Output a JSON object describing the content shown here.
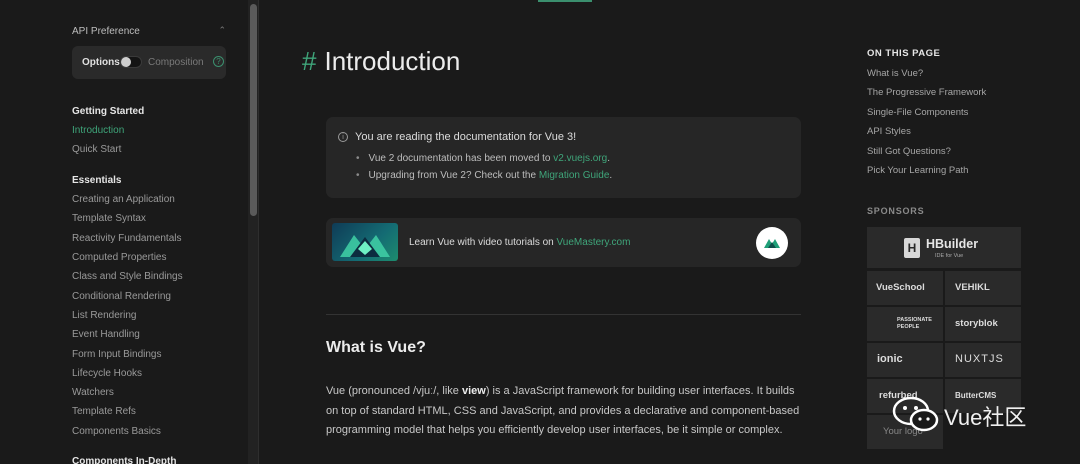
{
  "sidebar": {
    "api_preference": {
      "label": "API Preference",
      "options_label": "Options",
      "composition_label": "Composition"
    },
    "sections": [
      {
        "heading": "Getting Started",
        "items": [
          "Introduction",
          "Quick Start"
        ]
      },
      {
        "heading": "Essentials",
        "items": [
          "Creating an Application",
          "Template Syntax",
          "Reactivity Fundamentals",
          "Computed Properties",
          "Class and Style Bindings",
          "Conditional Rendering",
          "List Rendering",
          "Event Handling",
          "Form Input Bindings",
          "Lifecycle Hooks",
          "Watchers",
          "Template Refs",
          "Components Basics"
        ]
      },
      {
        "heading": "Components In-Depth",
        "items": []
      }
    ],
    "active_item": "Introduction"
  },
  "main": {
    "title_hash": "#",
    "title": "Introduction",
    "notice": {
      "title": "You are reading the documentation for Vue 3!",
      "item1_prefix": "Vue 2 documentation has been moved to ",
      "item1_link": "v2.vuejs.org",
      "item1_suffix": ".",
      "item2_prefix": "Upgrading from Vue 2? Check out the ",
      "item2_link": "Migration Guide",
      "item2_suffix": "."
    },
    "vuemastery": {
      "prefix": "Learn Vue with video tutorials on ",
      "link": "VueMastery.com"
    },
    "section_heading": "What is Vue?",
    "paragraph": {
      "p1": "Vue (pronounced /vjuː/, like ",
      "bold": "view",
      "p2": ") is a JavaScript framework for building user interfaces. It builds on top of standard HTML, CSS and JavaScript, and provides a declarative and component-based programming model that helps you efficiently develop user interfaces, be it simple or complex."
    }
  },
  "on_this_page": {
    "heading": "ON THIS PAGE",
    "items": [
      "What is Vue?",
      "The Progressive Framework",
      "Single-File Components",
      "API Styles",
      "Still Got Questions?",
      "Pick Your Learning Path"
    ]
  },
  "sponsors": {
    "heading": "SPONSORS",
    "featured": {
      "name": "HBuilder",
      "tagline": "IDE for Vue"
    },
    "logos": [
      "VueSchool",
      "VEHIKL",
      "PASSIONATE PEOPLE",
      "storyblok",
      "ionic",
      "NUXTJS",
      "refurbed",
      "ButterCMS",
      "Your logo"
    ]
  },
  "watermark": {
    "text": "Vue社区"
  },
  "colors": {
    "accent": "#3fa57a",
    "background": "#1a1a1a",
    "card": "#262626"
  }
}
